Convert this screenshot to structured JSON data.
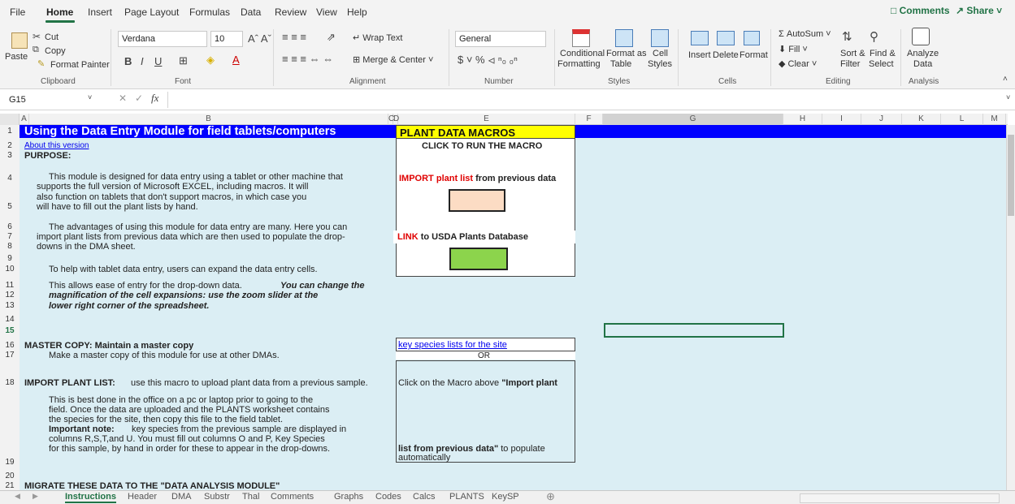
{
  "menu": {
    "tabs": [
      "File",
      "Home",
      "Insert",
      "Page Layout",
      "Formulas",
      "Data",
      "Review",
      "View",
      "Help"
    ],
    "comments": "Comments",
    "share": "Share"
  },
  "ribbon": {
    "clipboard": {
      "paste": "Paste",
      "cut": "Cut",
      "copy": "Copy",
      "format_painter": "Format Painter",
      "label": "Clipboard"
    },
    "font": {
      "family": "Verdana",
      "size": "10",
      "label": "Font"
    },
    "alignment": {
      "wrap_text": "Wrap Text",
      "merge_center": "Merge & Center",
      "label": "Alignment"
    },
    "number": {
      "format": "General",
      "label": "Number"
    },
    "styles": {
      "conditional": "Conditional",
      "formatting": "Formatting",
      "format_as": "Format as",
      "table": "Table",
      "cell": "Cell",
      "styles": "Styles",
      "label": "Styles"
    },
    "cells": {
      "insert": "Insert",
      "delete": "Delete",
      "format": "Format",
      "label": "Cells"
    },
    "editing": {
      "autosum": "AutoSum",
      "fill": "Fill",
      "clear": "Clear",
      "sort_filter_1": "Sort &",
      "sort_filter_2": "Filter",
      "find_select_1": "Find &",
      "find_select_2": "Select",
      "label": "Editing"
    },
    "analysis": {
      "analyze_1": "Analyze",
      "analyze_2": "Data",
      "label": "Analysis"
    }
  },
  "formula_bar": {
    "name_box": "G15",
    "fx": "fx",
    "value": ""
  },
  "columns": [
    "A",
    "B",
    "C",
    "D",
    "E",
    "F",
    "G",
    "H",
    "I",
    "J",
    "K",
    "L",
    "M"
  ],
  "rows": [
    "1",
    "2",
    "3",
    "4",
    "5",
    "6",
    "7",
    "8",
    "9",
    "10",
    "11",
    "12",
    "13",
    "14",
    "15",
    "16",
    "17",
    "18",
    "19",
    "20",
    "21"
  ],
  "sheet": {
    "title": "Using the Data Entry Module for field tablets/computers",
    "about": "About this version",
    "purpose": "PURPOSE:",
    "p4a": "This module is designed for data entry using a tablet or other machine that",
    "p4b": "supports the full version of Microsoft EXCEL, including macros.  It will",
    "p4c": "also function on tablets that don't support macros, in which case you",
    "p4d": "will have to fill out the plant lists by hand.",
    "p6a": "The advantages of using this module for data entry are many.  Here you can",
    "p6b": "import plant lists from previous data which are then used to populate the drop-",
    "p6c": "downs in the DMA sheet.",
    "p10": "To help with tablet data entry, users can expand the  data entry cells.",
    "p11a": "This allows ease of entry for the drop-down data.",
    "p11b": "You can change the",
    "p12": "magnification of the cell expansions:  use the zoom slider at the",
    "p13": "lower right corner of the spreadsheet.",
    "master_copy_h": "MASTER COPY: Maintain a master copy",
    "master_copy_t": "Make a master copy of this module for use at other DMAs.",
    "import_h": "IMPORT PLANT LIST:",
    "import_t": "use this macro to upload plant data from a previous sample.",
    "b18a": "This is best done in the office on a pc or laptop prior to going to the",
    "b18b": "field.  Once the data are uploaded and the PLANTS worksheet contains",
    "b18c": "the species for the site, then copy this file to the field tablet.",
    "b18d_b": "Important note:",
    "b18d": "key species from the previous sample are displayed in",
    "b18e": "columns R,S,T,and U.  You must fill out columns O and P, Key Species",
    "b18f": "for this sample, by hand in order for these to appear in the drop-downs.",
    "migrate_h": "MIGRATE THESE DATA TO THE \"DATA ANALYSIS MODULE\""
  },
  "macros": {
    "title": "PLANT DATA MACROS",
    "click": "CLICK TO RUN THE MACRO",
    "import_red": "IMPORT",
    "import_rest": "plant list",
    "import_end": "from previous data",
    "link_red": "LINK",
    "link_rest": "to USDA Plants Database",
    "import_color": "#fcdcc4",
    "link_color": "#8cd44c",
    "key_species": "key species lists for the site",
    "or": "OR",
    "click_macro": "Click on the Macro above",
    "import_plant_q": "\"Import plant",
    "list_from": "list from previous data\"",
    "to_populate": "to populate",
    "automatically": "automatically"
  },
  "sheet_tabs": [
    "Instructions",
    "Header",
    "DMA",
    "Substr",
    "Thal",
    "Comments",
    "Graphs",
    "Codes",
    "Calcs",
    "PLANTS",
    "KeySP"
  ],
  "colors": {
    "accent": "#217346",
    "title_band": "#0000ff",
    "sheet_bg": "#dbeef4",
    "macro_header": "#ffff00"
  }
}
